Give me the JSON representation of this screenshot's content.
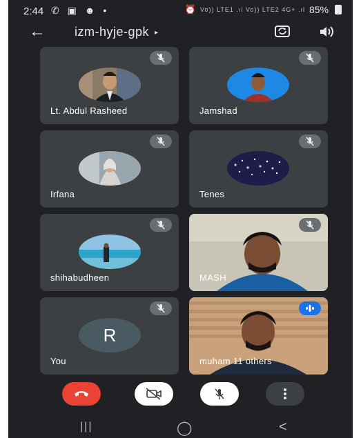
{
  "status_bar": {
    "time": "2:44",
    "left_icons": "✆ ▣ ☻ •",
    "network": "Vo)) LTE1 .ıl Vo)) LTE2 4G+ .ıl",
    "battery": "85%"
  },
  "top_bar": {
    "meeting_code": "izm-hyje-gpk",
    "chevron": "▸"
  },
  "participants": [
    {
      "name": "Lt. Abdul Rasheed"
    },
    {
      "name": "Jamshad"
    },
    {
      "name": "Irfana"
    },
    {
      "name": "Tenes"
    },
    {
      "name": "shihabudheen"
    },
    {
      "name": "MASH"
    },
    {
      "name": "You",
      "initial": "R"
    },
    {
      "name": "muham",
      "others": "11 others"
    }
  ],
  "colors": {
    "background": "#202124",
    "tile": "#3c4043",
    "end_call": "#ea4335",
    "control": "#ffffff",
    "more": "#3c4043",
    "speaking": "#1a73e8"
  },
  "controls": {
    "end_call_icon": "phone-hangup-icon",
    "camera_icon": "video-off-icon",
    "mic_icon": "mic-off-icon",
    "more_icon": "more-vertical-icon"
  },
  "nav": {
    "recents": "|||",
    "home": "◯",
    "back": "<"
  }
}
